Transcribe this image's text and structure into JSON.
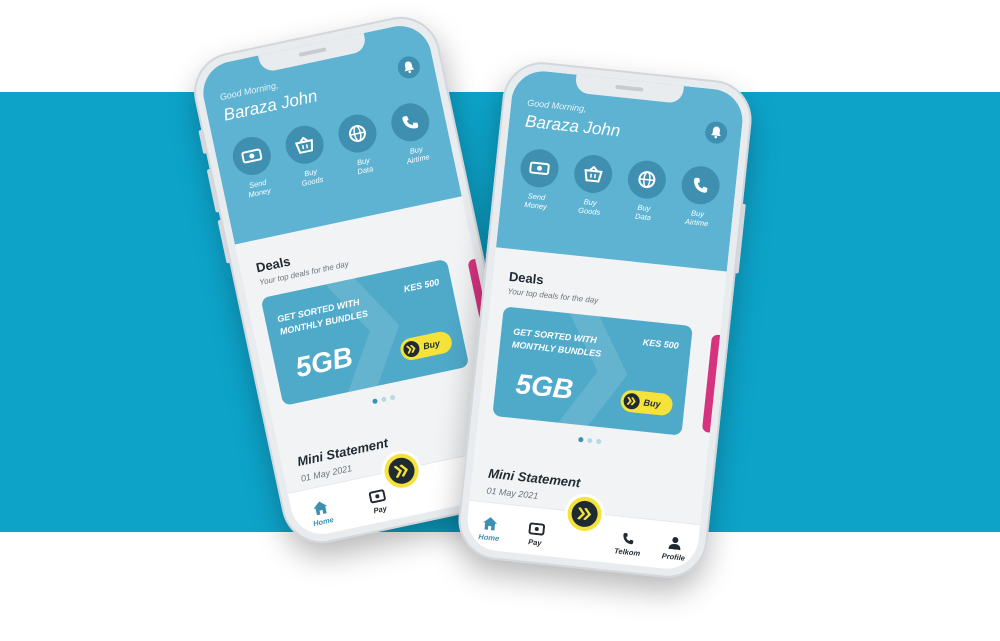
{
  "colors": {
    "band": "#0da3c9",
    "header": "#5db3d1",
    "accent": "#3f90b0",
    "yellow": "#f5e33a",
    "pink": "#d6337f"
  },
  "left_phone": {
    "greeting": "Good Morning,",
    "user_name": "Baraza John",
    "actions": [
      {
        "label": "Send\nMoney",
        "icon": "cash-icon"
      },
      {
        "label": "Buy\nGoods",
        "icon": "basket-icon"
      },
      {
        "label": "Buy\nData",
        "icon": "globe-icon"
      },
      {
        "label": "Buy\nAirtime",
        "icon": "phone-icon"
      }
    ],
    "deals": {
      "title": "Deals",
      "subtitle": "Your top deals for the day",
      "card": {
        "headline": "GET SORTED WITH\nMONTHLY BUNDLES",
        "price": "KES 500",
        "size": "5GB",
        "buy_label": "Buy"
      }
    },
    "mini_statement": {
      "title": "Mini Statement",
      "date": "01 May 2021"
    },
    "tabs": [
      {
        "label": "Home",
        "icon": "home-icon"
      },
      {
        "label": "Pay",
        "icon": "cash-icon"
      }
    ]
  },
  "right_phone": {
    "greeting": "Good Morning,",
    "user_name": "Baraza John",
    "actions": [
      {
        "label": "Send\nMoney",
        "icon": "cash-icon"
      },
      {
        "label": "Buy\nGoods",
        "icon": "basket-icon"
      },
      {
        "label": "Buy\nData",
        "icon": "globe-icon"
      },
      {
        "label": "Buy\nAirtime",
        "icon": "phone-icon"
      }
    ],
    "deals": {
      "title": "Deals",
      "subtitle": "Your top deals for the day",
      "card": {
        "headline": "GET SORTED WITH\nMONTHLY BUNDLES",
        "price": "KES 500",
        "size": "5GB",
        "buy_label": "Buy"
      }
    },
    "mini_statement": {
      "title": "Mini Statement",
      "date": "01 May 2021"
    },
    "tabs": [
      {
        "label": "Home",
        "icon": "home-icon"
      },
      {
        "label": "Pay",
        "icon": "cash-icon"
      },
      {
        "label": "Telkom",
        "icon": "phone-icon"
      },
      {
        "label": "Profile",
        "icon": "profile-icon"
      }
    ]
  }
}
